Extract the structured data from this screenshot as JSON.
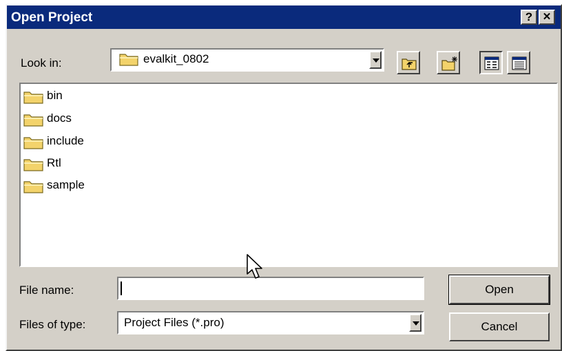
{
  "dialog": {
    "title": "Open Project",
    "help_glyph": "?",
    "close_glyph": "✕"
  },
  "look_in": {
    "label": "Look in:",
    "value": "evalkit_0802"
  },
  "files": [
    {
      "name": "bin"
    },
    {
      "name": "docs"
    },
    {
      "name": "include"
    },
    {
      "name": "Rtl"
    },
    {
      "name": "sample"
    }
  ],
  "file_name": {
    "label": "File name:",
    "value": ""
  },
  "files_of_type": {
    "label": "Files of type:",
    "value": "Project Files (*.pro)"
  },
  "buttons": {
    "open": "Open",
    "cancel": "Cancel"
  },
  "icons": {
    "folder": "folder-icon",
    "up": "up-one-level-icon",
    "new_folder": "new-folder-icon",
    "list": "list-view-icon",
    "details": "details-view-icon"
  },
  "colors": {
    "titlebar": "#0a2a7c",
    "face": "#d4d0c8",
    "folder": "#f3d36b"
  }
}
